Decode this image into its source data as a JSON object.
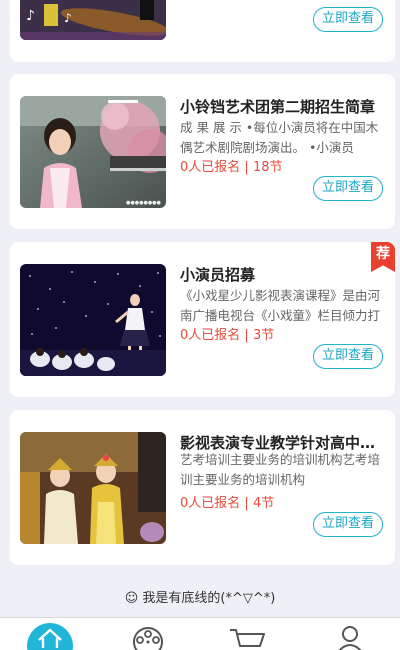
{
  "cards": [
    {
      "button_label": "立即查看"
    },
    {
      "title": "小铃铛艺术团第二期招生简章",
      "desc": "成 果 展 示 •每位小演员将在中国木偶艺术剧院剧场演出。 •小演员",
      "enrolled": "0人已报名",
      "separator": "|",
      "lessons": "18节",
      "button_label": "立即查看"
    },
    {
      "title": "小演员招募",
      "desc": "《小戏星少儿影视表演课程》是由河南广播电视台《小戏童》栏目倾力打造",
      "enrolled": "0人已报名",
      "separator": "|",
      "lessons": "3节",
      "button_label": "立即查看",
      "badge": "荐"
    },
    {
      "title": "影视表演专业教学针对高中学生",
      "desc": "艺考培训主要业务的培训机构艺考培训主要业务的培训机构",
      "enrolled": "0人已报名",
      "separator": "|",
      "lessons": "4节",
      "button_label": "立即查看"
    }
  ],
  "footer_text": "☺ 我是有底线的(*^▽^*)",
  "tabbar": {
    "items": [
      {
        "icon": "home-icon",
        "active": true
      },
      {
        "icon": "film-reel-icon",
        "active": false
      },
      {
        "icon": "cart-icon",
        "active": false
      },
      {
        "icon": "user-icon",
        "active": false
      }
    ]
  },
  "colors": {
    "accent": "#21b5d8",
    "price_red": "#e84d3d",
    "badge_red": "#e8412f",
    "background": "#eef0f5"
  }
}
